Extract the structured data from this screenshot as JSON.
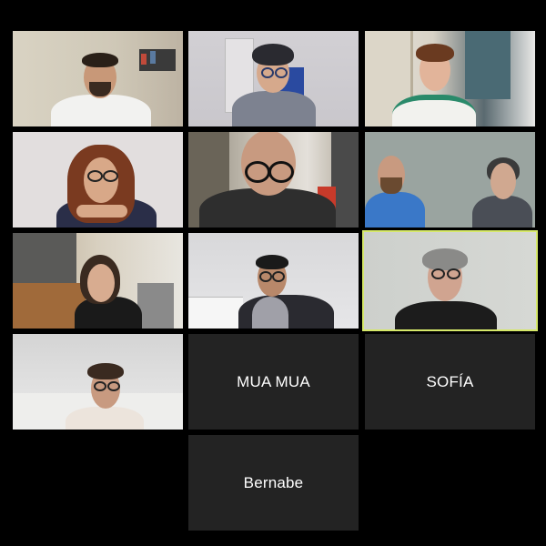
{
  "meeting": {
    "participants": [
      {
        "name": "",
        "video": true
      },
      {
        "name": "",
        "video": true
      },
      {
        "name": "",
        "video": true
      },
      {
        "name": "",
        "video": true
      },
      {
        "name": "",
        "video": true
      },
      {
        "name": "",
        "video": true
      },
      {
        "name": "",
        "video": true
      },
      {
        "name": "",
        "video": true
      },
      {
        "name": "",
        "video": true,
        "active_speaker": true
      },
      {
        "name": "",
        "video": true
      },
      {
        "name": "MUA MUA",
        "video": false
      },
      {
        "name": "SOFÍA",
        "video": false
      },
      {
        "name": "Bernabe",
        "video": false
      }
    ]
  },
  "colors": {
    "background": "#000000",
    "name_tile": "#232323",
    "active_speaker_border": "#d6e86a"
  }
}
